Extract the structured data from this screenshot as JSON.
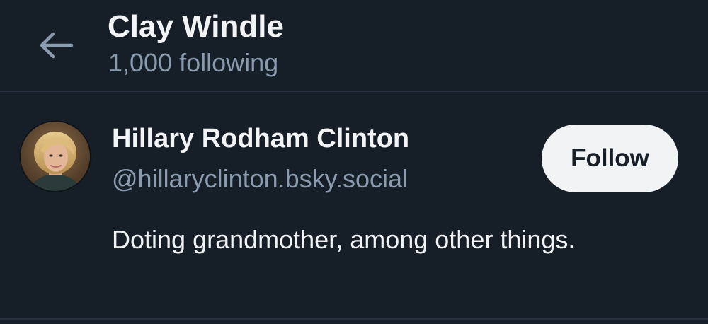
{
  "header": {
    "title": "Clay Windle",
    "subtitle": "1,000 following",
    "back_icon": "arrow-left-icon"
  },
  "profile": {
    "display_name": "Hillary Rodham Clinton",
    "handle": "@hillaryclinton.bsky.social",
    "bio": "Doting grandmother, among other things.",
    "follow_label": "Follow",
    "avatar_icon": "profile-photo"
  },
  "colors": {
    "background": "#161e27",
    "divider": "#27313d",
    "primary_text": "#f1f3f5",
    "secondary_text": "#8a9bb0",
    "button_bg": "#f1f3f5",
    "button_text": "#161e27"
  }
}
